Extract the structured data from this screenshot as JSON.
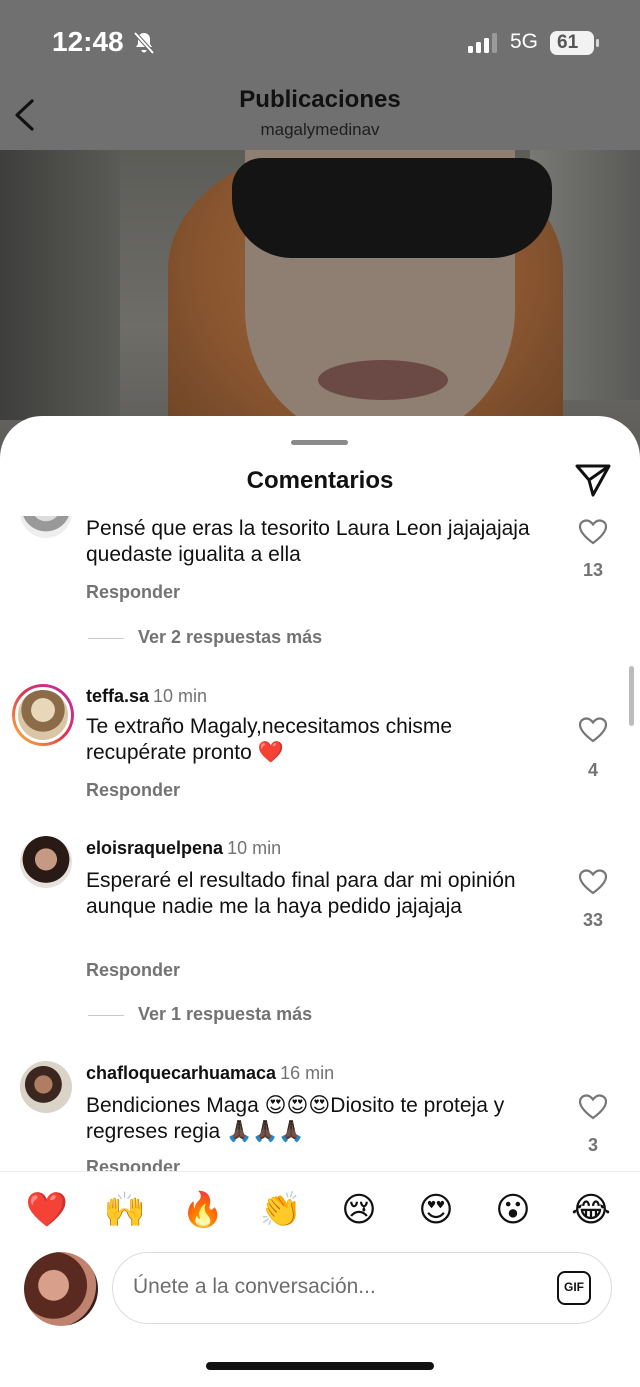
{
  "status": {
    "time": "12:48",
    "network": "5G",
    "battery": "61"
  },
  "header": {
    "title": "Publicaciones",
    "subtitle": "magalymedinav"
  },
  "sheet": {
    "title": "Comentarios"
  },
  "comments": [
    {
      "user": "",
      "ago": "",
      "text": "Pensé que eras la tesorito Laura Leon jajajajaja quedaste igualita a ella",
      "reply": "Responder",
      "likes": "13",
      "more": "Ver 2 respuestas más"
    },
    {
      "user": "teffa.sa",
      "ago": "10 min",
      "text": "Te extraño Magaly,necesitamos chisme recupérate pronto ❤️",
      "reply": "Responder",
      "likes": "4"
    },
    {
      "user": "eloisraquelpena",
      "ago": "10 min",
      "text": "Esperaré el resultado final para dar mi opinión aunque nadie me la haya pedido jajajaja",
      "reply": "Responder",
      "likes": "33",
      "more": "Ver 1 respuesta más"
    },
    {
      "user": "chafloquecarhuamaca",
      "ago": "16 min",
      "text": "Bendiciones Maga 😍😍😍Diosito te proteja y regreses regia 🙏🏿🙏🏿🙏🏿",
      "reply": "Responder",
      "likes": "3"
    }
  ],
  "reactions": [
    "❤️",
    "🙌",
    "🔥",
    "👏",
    "😢",
    "😍",
    "😮",
    "😂"
  ],
  "composer": {
    "placeholder": "Únete a la conversación...",
    "gif_label": "GIF"
  },
  "icons": [
    "back-chevron-icon",
    "bell-slash-icon",
    "signal-icon",
    "battery-icon",
    "share-icon",
    "heart-icon",
    "gif-icon"
  ]
}
